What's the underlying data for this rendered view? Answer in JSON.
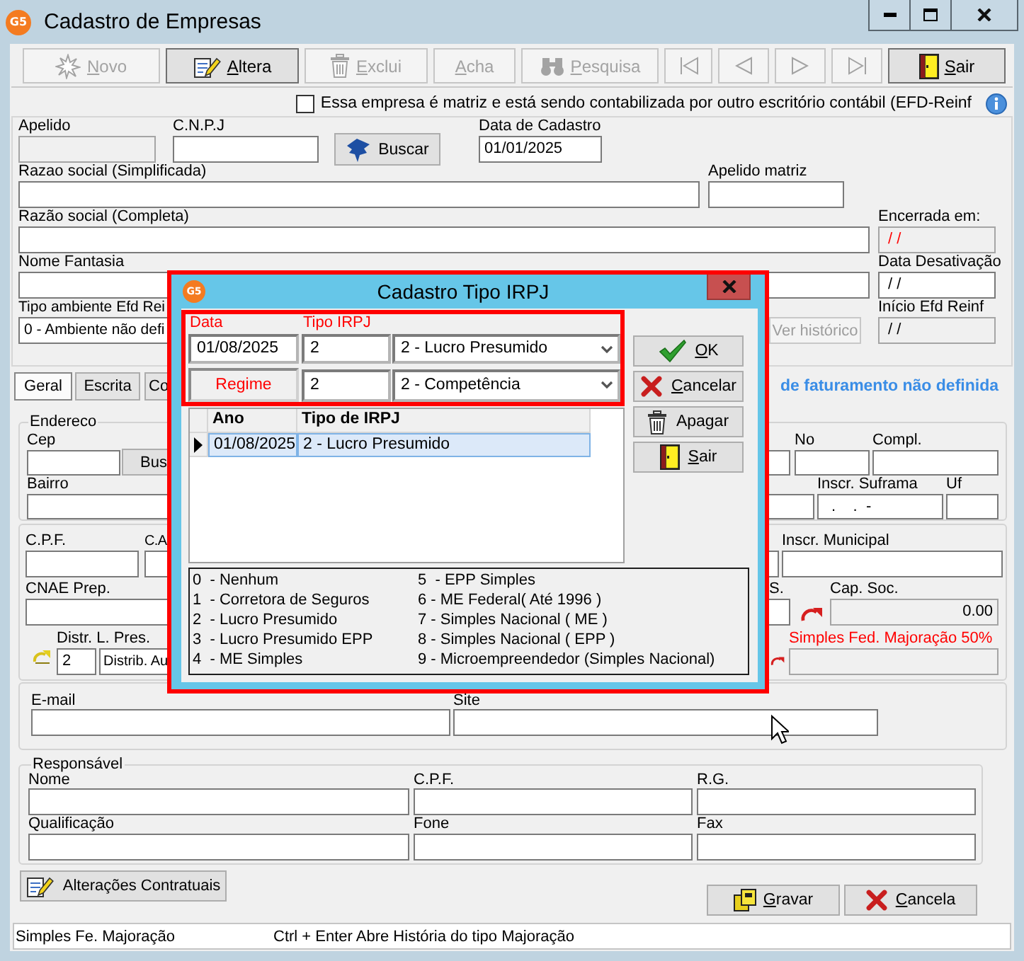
{
  "window": {
    "title": "Cadastro de Empresas",
    "logo": "G5"
  },
  "toolbar": [
    {
      "kind": "text",
      "label": "Novo",
      "hotkey": true,
      "disabled": true
    },
    {
      "kind": "text",
      "label": "Altera",
      "hotkey": true,
      "disabled": false
    },
    {
      "kind": "text",
      "label": "Exclui",
      "hotkey": true,
      "disabled": true
    },
    {
      "kind": "text",
      "label": "Acha",
      "hotkey": true,
      "disabled": true
    },
    {
      "kind": "text",
      "label": "Pesquisa",
      "hotkey": true,
      "disabled": true
    },
    {
      "kind": "nav",
      "disabled": true
    },
    {
      "kind": "nav",
      "disabled": true
    },
    {
      "kind": "nav",
      "disabled": true
    },
    {
      "kind": "nav",
      "disabled": true
    },
    {
      "kind": "text",
      "label": "Sair",
      "hotkey": true,
      "disabled": false
    }
  ],
  "matrix_checkbox": {
    "label": "Essa empresa é matriz e está sendo contabilizada por outro escritório contábil (EFD-Reinf",
    "checked": false
  },
  "company": {
    "apelido": {
      "label": "Apelido",
      "disabled": true
    },
    "cnpj": {
      "label": "C.N.P.J",
      "disabled": false
    },
    "buscar_button": {
      "label": "Buscar"
    },
    "data_cadastro": {
      "label": "Data de Cadastro",
      "value": "01/01/2025",
      "disabled": false
    },
    "razao_simplificada": {
      "label": "Razao social (Simplificada)",
      "disabled": false
    },
    "apelido_matriz": {
      "label": "Apelido matriz",
      "disabled": false
    },
    "razao_completa": {
      "label": "Razão social (Completa)",
      "disabled": false
    },
    "encerrada_em": {
      "label": "Encerrada em:",
      "value": "/ /",
      "disabled": true
    },
    "nome_fantasia": {
      "label": "Nome Fantasia",
      "disabled": false
    },
    "data_desativacao": {
      "label": "Data Desativação",
      "value": "/ /",
      "disabled": false
    },
    "tipo_ambiente": {
      "label": "Tipo ambiente Efd Rei",
      "value": "0 - Ambiente não defi",
      "disabled": false
    },
    "ver_historico_button": {
      "label": "Ver histórico",
      "disabled": true
    },
    "inicio_efd_reinf": {
      "label": "Início Efd Reinf",
      "value": "/ /",
      "disabled": true
    }
  },
  "tabs": [
    {
      "label": "Geral",
      "selected": true
    },
    {
      "label": "Escrita",
      "selected": false
    },
    {
      "label": "Co",
      "selected": false
    }
  ],
  "notice": "de faturamento não definida",
  "endereco": {
    "title": "Endereco",
    "cep": {
      "label": "Cep"
    },
    "buscar_cep_button": {
      "label": "Bus"
    },
    "bairro": {
      "label": "Bairro"
    },
    "numero": {
      "label": "No"
    },
    "complemento": {
      "label": "Compl."
    },
    "inscr_suframa": {
      "label": "Inscr. Suframa",
      "value": ".    .  -"
    },
    "uf": {
      "label": "Uf"
    }
  },
  "fiscal": {
    "cpf": {
      "label": "C.P.F."
    },
    "column_2": {
      "label": "C.A"
    },
    "inscr_municipal": {
      "label": "Inscr. Municipal"
    },
    "cnae": {
      "label": "CNAE Prep."
    },
    "column_5": {
      "label": "S."
    },
    "cap_soc": {
      "label": "Cap. Soc.",
      "value": "0.00",
      "disabled": true
    },
    "distr_l_pres": {
      "label": "Distr. L. Pres.",
      "code": "2",
      "value": "Distrib. Au"
    },
    "simples_fed": {
      "label": "Simples Fed. Majoração 50%",
      "disabled": true
    }
  },
  "contato": {
    "email": {
      "label": "E-mail"
    },
    "site": {
      "label": "Site"
    }
  },
  "responsavel": {
    "title": "Responsável",
    "nome": {
      "label": "Nome"
    },
    "cpf": {
      "label": "C.P.F."
    },
    "rg": {
      "label": "R.G."
    },
    "qualificacao": {
      "label": "Qualificação"
    },
    "fone": {
      "label": "Fone"
    },
    "fax": {
      "label": "Fax"
    }
  },
  "alteracoes_button": {
    "label": "Alterações Contratuais"
  },
  "gravar_button": {
    "label": "Gravar",
    "hotkey": true
  },
  "cancela_button": {
    "label": "Cancela",
    "hotkey": true
  },
  "status_bar": [
    "Simples Fe. Majoração",
    "Ctrl + Enter Abre História do tipo Majoração"
  ],
  "dialog": {
    "title": "Cadastro Tipo IRPJ",
    "logo": "G5",
    "highlighted": true,
    "entry_highlighted": true,
    "data": {
      "label": "Data",
      "value": "01/08/2025"
    },
    "tipo_irpj": {
      "label": "Tipo IRPJ",
      "code": "2",
      "value": "2 - Lucro Presumido"
    },
    "regime": {
      "label": "Regime",
      "code": "2",
      "value": "2 - Competência"
    },
    "table": {
      "columns": [
        "Ano",
        "Tipo de IRPJ"
      ],
      "rows": [
        {
          "cells": [
            "01/08/2025",
            "2 - Lucro Presumido"
          ],
          "selected": true
        }
      ]
    },
    "buttons": [
      {
        "label": "OK",
        "hotkey": true
      },
      {
        "label": "Cancelar",
        "hotkey": true
      },
      {
        "label": "Apagar",
        "hotkey": false
      },
      {
        "label": "Sair",
        "hotkey": true
      }
    ],
    "legend": [
      "0  - Nenhum",
      "1  - Corretora de Seguros",
      "2  - Lucro Presumido",
      "3  - Lucro Presumido EPP",
      "4  - ME Simples",
      "5  - EPP Simples",
      "6 - ME Federal( Até 1996 )",
      "7 - Simples Nacional ( ME )",
      "8 - Simples Nacional ( EPP )",
      "9 - Microempreendedor (Simples Nacional)"
    ]
  }
}
